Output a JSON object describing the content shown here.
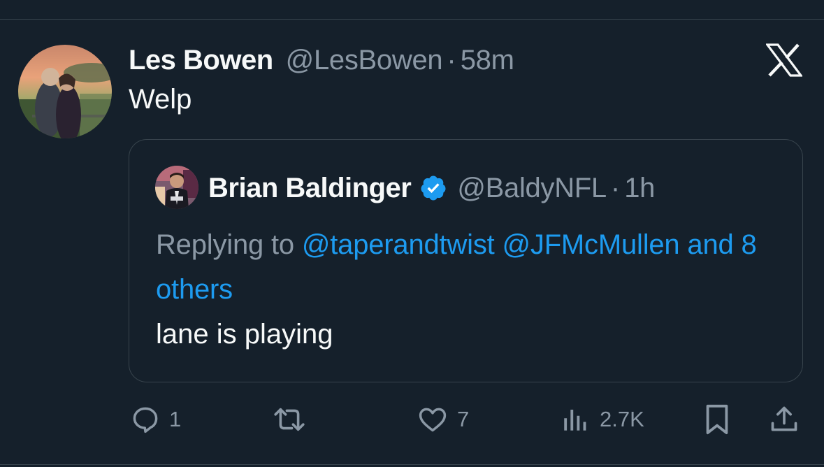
{
  "tweet": {
    "author_name": "Les Bowen",
    "author_handle": "@LesBowen",
    "separator": "·",
    "timestamp": "58m",
    "text": "Welp"
  },
  "quoted": {
    "author_name": "Brian Baldinger",
    "author_handle": "@BaldyNFL",
    "separator": "·",
    "timestamp": "1h",
    "replying_prefix": "Replying to",
    "mentions": [
      "@taperandtwist",
      "@JFMcMullen"
    ],
    "others": "and 8 others",
    "text": "lane is playing"
  },
  "actions": {
    "replies": "1",
    "reposts": "",
    "likes": "7",
    "views": "2.7K"
  },
  "icons": {
    "brand": "x-logo-icon",
    "verified": "verified-badge-icon",
    "reply": "reply-icon",
    "repost": "repost-icon",
    "like": "heart-icon",
    "views": "views-chart-icon",
    "bookmark": "bookmark-icon",
    "share": "share-icon"
  },
  "colors": {
    "background": "#15202b",
    "text": "#f7f9f9",
    "muted": "#8b98a5",
    "accent": "#1d9bf0",
    "border": "#38444d"
  }
}
